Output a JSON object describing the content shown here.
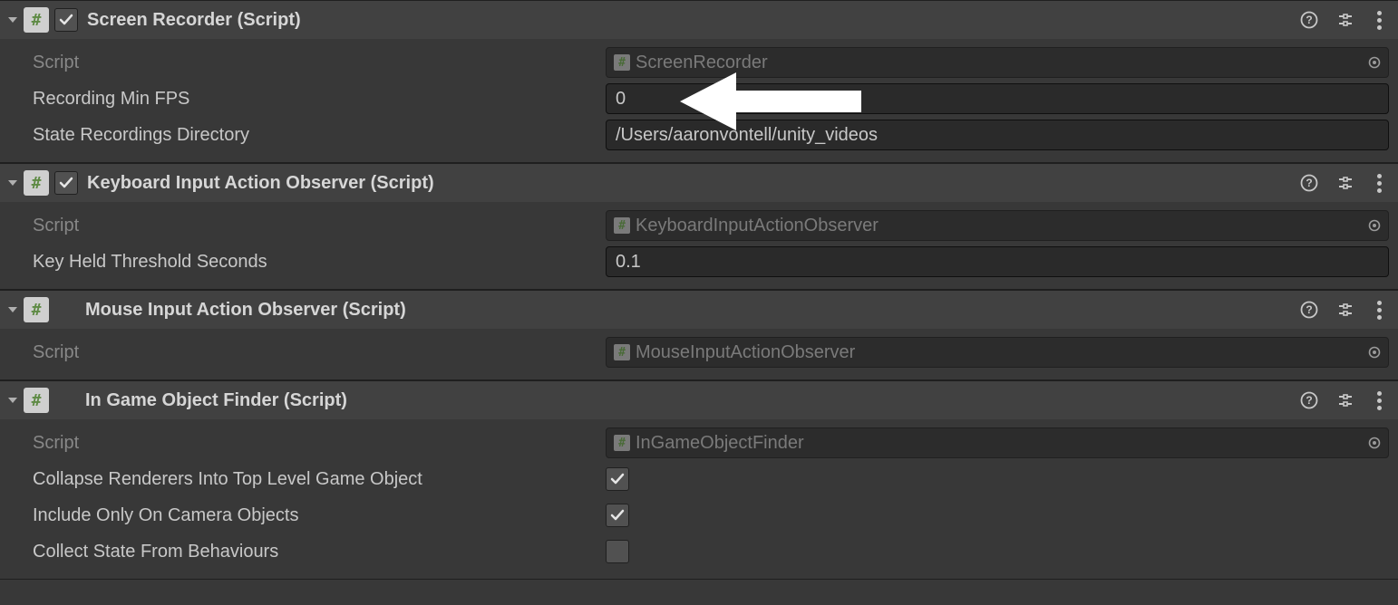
{
  "components": [
    {
      "title": "Screen Recorder (Script)",
      "hasCheckbox": true,
      "checked": true,
      "fields": {
        "scriptLabel": "Script",
        "scriptValue": "ScreenRecorder",
        "recordingMinFpsLabel": "Recording Min FPS",
        "recordingMinFpsValue": "0",
        "stateDirLabel": "State Recordings Directory",
        "stateDirValue": "/Users/aaronvontell/unity_videos"
      }
    },
    {
      "title": "Keyboard Input Action Observer (Script)",
      "hasCheckbox": true,
      "checked": true,
      "fields": {
        "scriptLabel": "Script",
        "scriptValue": "KeyboardInputActionObserver",
        "keyHeldLabel": "Key Held Threshold Seconds",
        "keyHeldValue": "0.1"
      }
    },
    {
      "title": "Mouse Input Action Observer (Script)",
      "hasCheckbox": false,
      "fields": {
        "scriptLabel": "Script",
        "scriptValue": "MouseInputActionObserver"
      }
    },
    {
      "title": "In Game Object Finder (Script)",
      "hasCheckbox": false,
      "fields": {
        "scriptLabel": "Script",
        "scriptValue": "InGameObjectFinder",
        "collapseLabel": "Collapse Renderers Into Top Level Game Object",
        "collapseChecked": true,
        "includeLabel": "Include Only On Camera Objects",
        "includeChecked": true,
        "collectLabel": "Collect State From Behaviours",
        "collectChecked": false
      }
    }
  ]
}
